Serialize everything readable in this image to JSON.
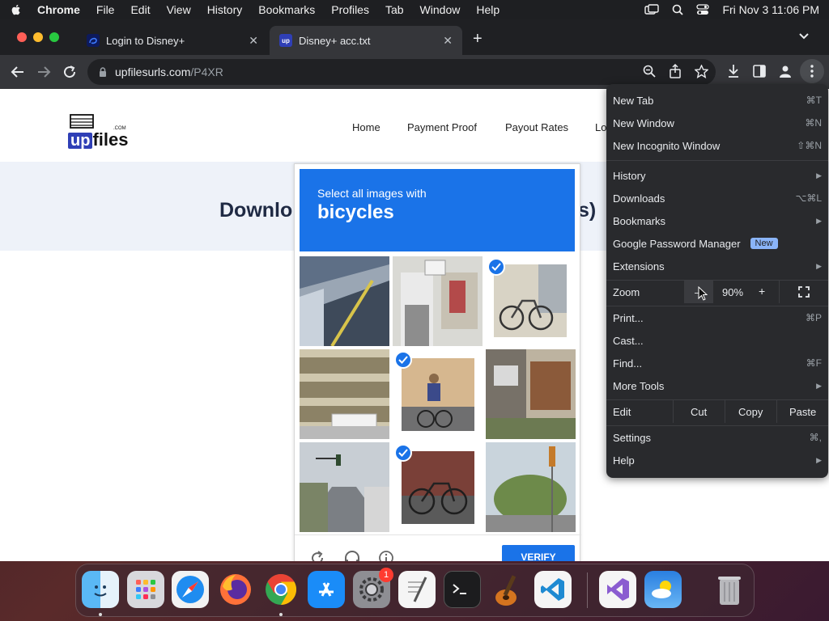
{
  "menubar": {
    "app": "Chrome",
    "items": [
      "File",
      "Edit",
      "View",
      "History",
      "Bookmarks",
      "Profiles",
      "Tab",
      "Window",
      "Help"
    ],
    "datetime": "Fri Nov 3  11:06 PM"
  },
  "tabs": [
    {
      "title": "Login to Disney+",
      "favicon": "disney-plus-favicon"
    },
    {
      "title": "Disney+ acc.txt",
      "favicon": "upfiles-favicon"
    }
  ],
  "omnibox": {
    "host": "upfilesurls.com",
    "path": "/P4XR"
  },
  "site": {
    "logo_up": "up",
    "logo_files": "files",
    "logo_com": ".COM",
    "nav": [
      "Home",
      "Payment Proof",
      "Payout Rates",
      "Lo"
    ],
    "title_left": "Downlo",
    "title_right": "s)"
  },
  "captcha": {
    "instruction": "Select all images with",
    "target": "bicycles",
    "verify_label": "VERIFY",
    "selected_cells": [
      2,
      4,
      7
    ]
  },
  "chrome_menu": {
    "new_tab": "New Tab",
    "new_tab_sc": "⌘T",
    "new_window": "New Window",
    "new_window_sc": "⌘N",
    "new_incognito": "New Incognito Window",
    "new_incognito_sc": "⇧⌘N",
    "history": "History",
    "downloads": "Downloads",
    "downloads_sc": "⌥⌘L",
    "bookmarks": "Bookmarks",
    "password_manager": "Google Password Manager",
    "new_badge": "New",
    "extensions": "Extensions",
    "zoom": "Zoom",
    "zoom_minus": "–",
    "zoom_value": "90%",
    "zoom_plus": "+",
    "print": "Print...",
    "print_sc": "⌘P",
    "cast": "Cast...",
    "find": "Find...",
    "find_sc": "⌘F",
    "more_tools": "More Tools",
    "edit": "Edit",
    "cut": "Cut",
    "copy": "Copy",
    "paste": "Paste",
    "settings": "Settings",
    "settings_sc": "⌘,",
    "help": "Help"
  },
  "dock": {
    "apps": [
      "finder-icon",
      "launchpad-icon",
      "safari-icon",
      "firefox-icon",
      "chrome-icon",
      "app-store-icon",
      "system-settings-icon",
      "textedit-icon",
      "terminal-icon",
      "garageband-icon",
      "vscode-icon",
      "visual-studio-icon",
      "weather-icon",
      "trash-icon"
    ],
    "settings_badge": "1"
  },
  "colors": {
    "accent": "#1a73e8",
    "menu_bg": "#292a2d",
    "tab_bg": "#1f2023"
  }
}
